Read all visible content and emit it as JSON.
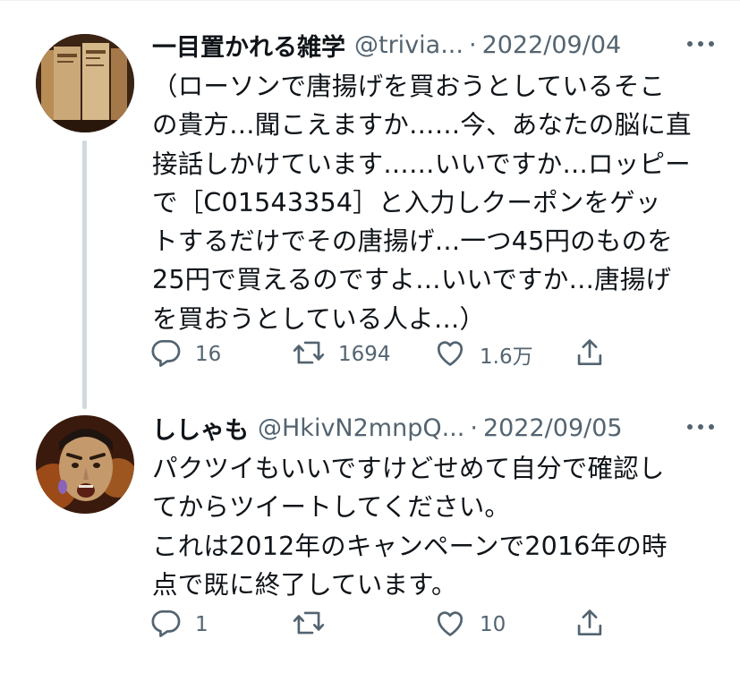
{
  "tweets": [
    {
      "display_name": "一目置かれる雑学",
      "handle": "@trivia...",
      "separator": "·",
      "date": "2022/09/04",
      "text": "（ローソンで唐揚げを買おうとしているそこ\nの貴方…聞こえますか……今、あなたの脳に直\n接話しかけています……いいですか…ロッピー\nで［C01543354］と入力しクーポンをゲッ\nトするだけでその唐揚げ…一つ45円のものを\n25円で買えるのですよ…いいですか…唐揚げ\nを買おうとしている人よ…）",
      "counts": {
        "reply": "16",
        "retweet": "1694",
        "like": "1.6万"
      },
      "avatar": "bookshelf-avatar"
    },
    {
      "display_name": "ししゃも",
      "handle": "@HkivN2mnpQ...",
      "separator": "·",
      "date": "2022/09/05",
      "text": "パクツイもいいですけどせめて自分で確認し\nてからツイートしてください。\nこれは2012年のキャンペーンで2016年の時\n点で既に終了しています。",
      "counts": {
        "reply": "1",
        "retweet": "",
        "like": "10"
      },
      "avatar": "character-face-avatar"
    }
  ],
  "icons": [
    "more-icon",
    "reply-icon",
    "retweet-icon",
    "like-icon",
    "share-icon"
  ],
  "colors": {
    "text": "#0f1419",
    "secondary": "#536471",
    "thread_line": "#cfd9de",
    "divider": "#eff3f4"
  }
}
